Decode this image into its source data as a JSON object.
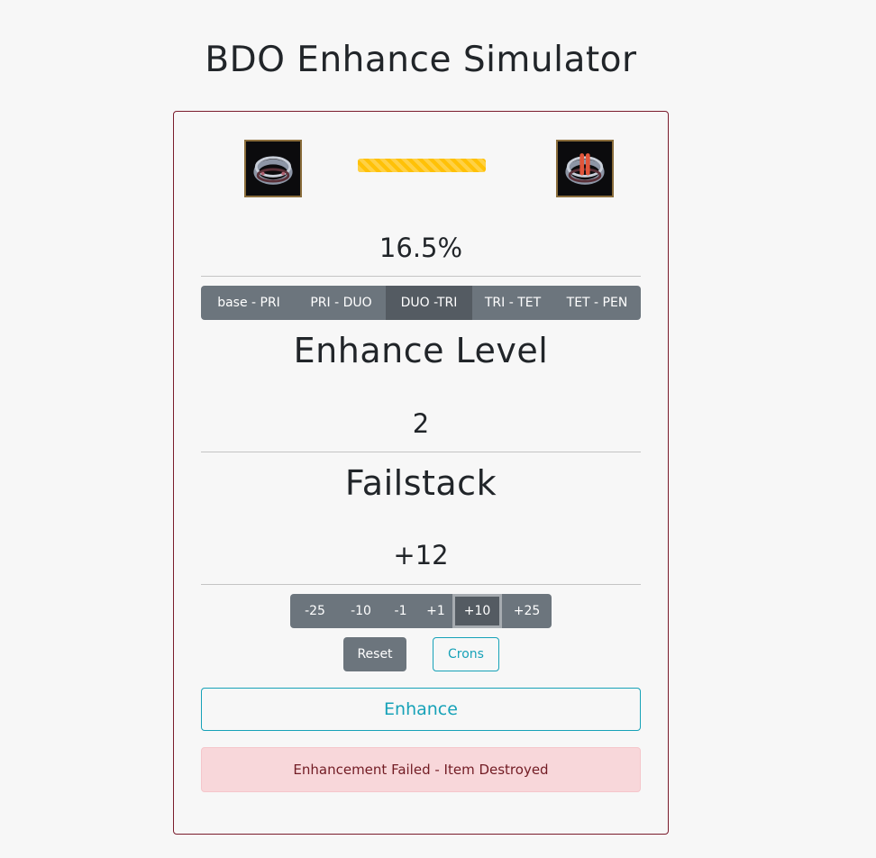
{
  "app": {
    "title": "BDO Enhance Simulator"
  },
  "item": {
    "current_icon": "ring-icon",
    "next_icon": "ring-enhanced-icon",
    "progress_percent": 100,
    "progress_color": "#ffc107"
  },
  "chance": {
    "value": "16.5%"
  },
  "tiers": [
    {
      "label": "base - PRI",
      "active": false
    },
    {
      "label": "PRI - DUO",
      "active": false
    },
    {
      "label": "DUO -TRI",
      "active": true
    },
    {
      "label": "TRI - TET",
      "active": false
    },
    {
      "label": "TET - PEN",
      "active": false
    }
  ],
  "enhance_level": {
    "heading": "Enhance Level",
    "value": "2"
  },
  "failstack": {
    "heading": "Failstack",
    "value": "+12",
    "adjust_buttons": [
      "-25",
      "-10",
      "-1",
      "+1",
      "+10",
      "+25"
    ],
    "focused_button": "+10"
  },
  "actions": {
    "reset_label": "Reset",
    "crons_label": "Crons",
    "enhance_label": "Enhance"
  },
  "alert": {
    "message": "Enhancement Failed - Item Destroyed",
    "color": "#f8d7da"
  },
  "colors": {
    "accent": "#17a2b8",
    "secondary": "#6c757d",
    "card_border": "#7a1c2c"
  }
}
